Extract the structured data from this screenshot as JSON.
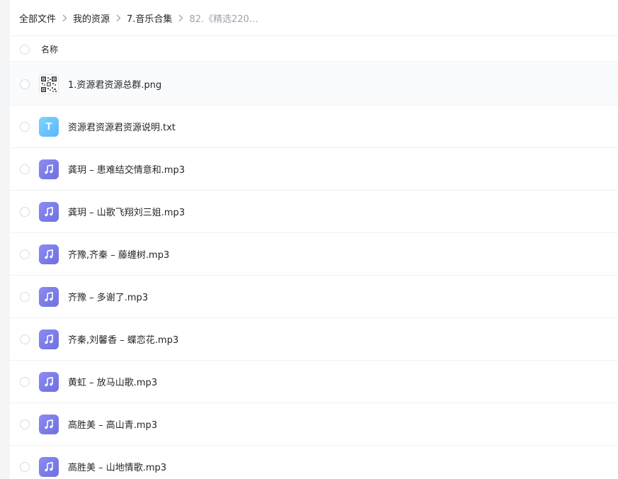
{
  "breadcrumb": {
    "items": [
      "全部文件",
      "我的资源",
      "7.音乐合集"
    ],
    "current": "82.《精选220…"
  },
  "header": {
    "name_label": "名称"
  },
  "files": [
    {
      "name": "1.资源君资源总群.png",
      "icon": "qr-image-icon"
    },
    {
      "name": "资源君资源君资源说明.txt",
      "icon": "txt-file-icon",
      "icon_letter": "T"
    },
    {
      "name": "龚玥 – 患难结交情意和.mp3",
      "icon": "music-note-icon"
    },
    {
      "name": "龚玥 – 山歌飞翔刘三姐.mp3",
      "icon": "music-note-icon"
    },
    {
      "name": "齐豫,齐秦 – 藤缠树.mp3",
      "icon": "music-note-icon"
    },
    {
      "name": "齐豫 – 多谢了.mp3",
      "icon": "music-note-icon"
    },
    {
      "name": "齐秦,刘馨香 – 蝶恋花.mp3",
      "icon": "music-note-icon"
    },
    {
      "name": "黄虹 – 放马山歌.mp3",
      "icon": "music-note-icon"
    },
    {
      "name": "高胜美 – 高山青.mp3",
      "icon": "music-note-icon"
    },
    {
      "name": "高胜美 – 山地情歌.mp3",
      "icon": "music-note-icon"
    }
  ],
  "colors": {
    "music_icon": "#7b7beb",
    "txt_icon": "#6cc6fb",
    "text": "#25262b",
    "muted_text": "#9da3ad"
  }
}
